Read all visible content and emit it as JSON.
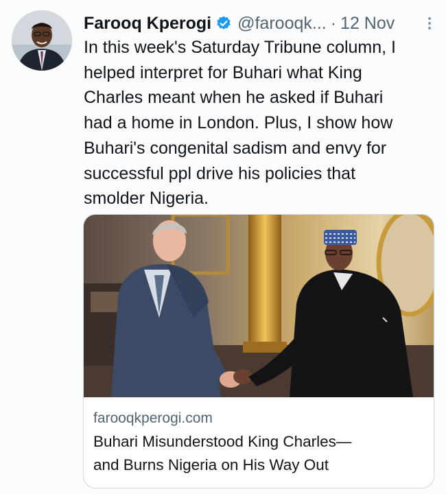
{
  "tweet": {
    "author_name": "Farooq Kperogi",
    "handle": "@farooqk...",
    "separator": "·",
    "timestamp": "12 Nov",
    "text": "In this week's Saturday Tribune column, I\nhelped interpret for Buhari what King\nCharles meant when he asked if Buhari\nhad a home in London. Plus, I show how\nBuhari's congenital sadism and envy for\nsuccessful ppl drive his policies that\nsmolder Nigeria."
  },
  "icons": {
    "verified": "verified-badge-icon",
    "more": "more-options-icon"
  },
  "link_card": {
    "domain": "farooqkperogi.com",
    "title": "Buhari Misunderstood King Charles—\nand Burns Nigeria on His Way Out"
  },
  "colors": {
    "text_primary": "#0f1419",
    "text_secondary": "#536471",
    "verified_blue": "#1d9bf0",
    "card_border": "#cfd9de"
  }
}
